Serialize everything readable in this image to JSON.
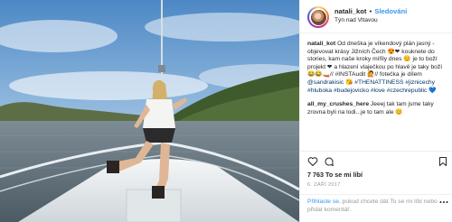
{
  "post": {
    "photo": {
      "icon": "photo-boat-lake"
    },
    "header": {
      "username": "natali_kot",
      "separator": "•",
      "follow_label": "Sledování",
      "location": "Týn nad Vltavou"
    },
    "caption": {
      "username": "natali_kot",
      "text": "Od dneška je víkendový plán jasný - objevovat krásy Jižních Čech 😍❤ kouknete do stories, kam naše kroky mířily dnes 😊 je to boží projekt ❤ a hlazení vlaječkou po hlavě je taky boží 😂😂🚤//",
      "mention_prefix": "#INSTAudit 🙋// fotečka je dílem",
      "mention": "@sandrakisic 😘 ",
      "hashtags": "#THENATTINESS #jiznicechy #hluboka #budejovicko #love #czechrepublic 💙"
    },
    "comment": {
      "username": "all_my_crushes_here",
      "text": "Jeeej tak tam jsme taky zrovna byli na lodi...je to tam ale 😊"
    },
    "actions": {
      "like_icon": "heart-icon",
      "comment_icon": "comment-icon",
      "save_icon": "bookmark-icon",
      "likes_text": "7 763 To se mi líbí",
      "date": "6. ZÁŘÍ 2017"
    },
    "login_prompt": {
      "link": "Přihlaste se",
      "text": ", pokud chcete dát To se mi líbí nebo přidat komentář."
    },
    "colors": {
      "link": "#3897f0",
      "text": "#262626",
      "muted": "#999999",
      "border": "#efefef"
    }
  }
}
